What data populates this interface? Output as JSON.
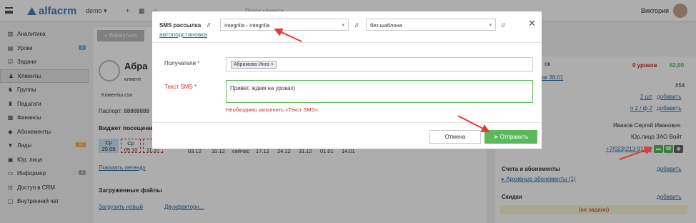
{
  "topbar": {
    "logo": "alfacrm",
    "branch": "demo",
    "search_placeholder": "Поиск клиента",
    "user": "Виктория"
  },
  "sidebar": {
    "items": [
      {
        "label": "Аналитика",
        "icon": "chart-icon"
      },
      {
        "label": "Уроки",
        "icon": "calendar-icon",
        "badge": "3",
        "badge_color": "#5bc0de"
      },
      {
        "label": "Задачи",
        "icon": "checkbox-icon"
      },
      {
        "label": "Клиенты",
        "icon": "user-icon",
        "active": true
      },
      {
        "label": "Группы",
        "icon": "group-icon"
      },
      {
        "label": "Педагоги",
        "icon": "teacher-icon"
      },
      {
        "label": "Финансы",
        "icon": "finance-icon"
      },
      {
        "label": "Абонементы",
        "icon": "ticket-icon"
      },
      {
        "label": "Лиды",
        "icon": "funnel-icon",
        "badge": "32",
        "badge_color": "#f0ad4e"
      },
      {
        "label": "Юр. лица",
        "icon": "building-icon"
      },
      {
        "label": "Информер",
        "icon": "chat-icon",
        "badge": "1",
        "badge_color": "#aaa"
      },
      {
        "label": "Доступ в CRM",
        "icon": "lock-icon"
      },
      {
        "label": "Внутренний чат",
        "icon": "comment-icon"
      }
    ]
  },
  "main": {
    "back_label": "« Вернуться",
    "client_name": "Абра",
    "client_type": "клиент",
    "file_name": "Клиенты.csv",
    "passport": "Паспорт: 88888888",
    "widget_title": "Виджет посещени",
    "attendance": [
      {
        "day": "Ср",
        "date": "25.09"
      },
      {
        "day": "Ср",
        "date": "09.10"
      },
      {
        "day": "",
        "date": "11.10"
      }
    ],
    "attendance_plain": [
      "03.12",
      "10.12",
      "сейчас",
      "17.12",
      "24.12",
      "31.12",
      "01.01",
      "14.01"
    ],
    "legend_link": "Показать легенду",
    "files_title": "Загруженные файлы",
    "upload_new": "Загрузить новый",
    "two_factor": "Двухфакторн..."
  },
  "right": {
    "lessons_count": "0 уроков",
    "balance": "62,00",
    "time_link": "ак 38:01",
    "ok_suffix": "ок",
    "num": "#54",
    "pieces": "2 шт",
    "ratio": "п 2 / ф 2",
    "add": "добавить",
    "teacher": "Иванов Сергей Иванович",
    "legal": "Юр.лицо ЗАО Войт",
    "phone": "+7(923)213-91-99",
    "accounts": "Счета и абонементы",
    "archive": "Архивные абонементы (1)",
    "discounts": "Скидки",
    "not_set": "(не задано)"
  },
  "modal": {
    "title": "SMS рассылка",
    "sep": "//",
    "provider": "Integrilla - Integrilla",
    "template": "без шаблона",
    "autosubst": "автоподстановка",
    "recipients_label": "Получатели",
    "recipient_tag": "Абрамова Инга ×",
    "text_label": "Текст SMS",
    "required_mark": "*",
    "text_value": "Привет, ждем на уроках)",
    "error": "Необходимо заполнить «Текст SMS».",
    "cancel": "Отмена",
    "send": "Отправить",
    "close": "✕"
  },
  "colors": {
    "accent": "#5cb85c",
    "link": "#2d6ca2",
    "error": "#c9302c",
    "arrow": "#e53935"
  }
}
